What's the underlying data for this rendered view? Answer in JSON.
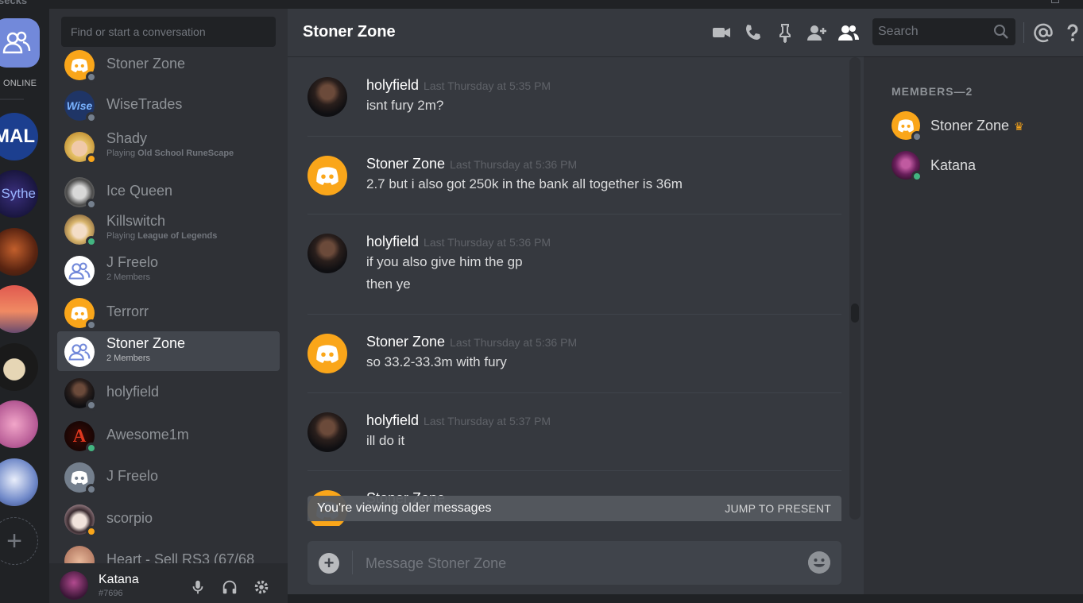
{
  "app": {
    "title": "secks"
  },
  "guilds": {
    "online_label": "ONLINE"
  },
  "dm_search": {
    "placeholder": "Find or start a conversation"
  },
  "dm_list": [
    {
      "name": "Stoner Zone",
      "sub": "",
      "status": "offline",
      "avatar": "discord-orange"
    },
    {
      "name": "WiseTrades",
      "sub": "",
      "status": "offline",
      "avatar": "wise"
    },
    {
      "name": "Shady",
      "sub_prefix": "Playing ",
      "sub_bold": "Old School RuneScape",
      "status": "idle",
      "avatar": "face-blond"
    },
    {
      "name": "Ice Queen",
      "sub": "",
      "status": "offline",
      "avatar": "dog"
    },
    {
      "name": "Killswitch",
      "sub_prefix": "Playing ",
      "sub_bold": "League of Legends",
      "status": "online",
      "avatar": "anime-blond"
    },
    {
      "name": "J Freelo",
      "sub": "2 Members",
      "status": "",
      "avatar": "group"
    },
    {
      "name": "Terrorr",
      "sub": "",
      "status": "offline",
      "avatar": "discord-orange"
    },
    {
      "name": "Stoner Zone",
      "sub": "2 Members",
      "status": "",
      "avatar": "group",
      "selected": true
    },
    {
      "name": "holyfield",
      "sub": "",
      "status": "offline",
      "avatar": "boxer"
    },
    {
      "name": "Awesome1m",
      "sub": "",
      "status": "online",
      "avatar": "letter-a"
    },
    {
      "name": "J Freelo",
      "sub": "",
      "status": "offline",
      "avatar": "discord-gray"
    },
    {
      "name": "scorpio",
      "sub": "",
      "status": "idle",
      "avatar": "anime-dark"
    },
    {
      "name": "Heart - Sell RS3 (67/68",
      "sub": "",
      "status": "",
      "avatar": "face-skin"
    }
  ],
  "user_panel": {
    "name": "Katana",
    "tag": "#7696"
  },
  "chat": {
    "title": "Stoner Zone",
    "search_placeholder": "Search",
    "messages": [
      {
        "author": "holyfield",
        "timestamp": "Last Thursday at 5:35 PM",
        "lines": [
          "isnt fury 2m?"
        ],
        "avatar": "boxer"
      },
      {
        "author": "Stoner Zone",
        "timestamp": "Last Thursday at 5:36 PM",
        "lines": [
          "2.7 but i also got 250k in the bank all together is 36m"
        ],
        "avatar": "discord-orange"
      },
      {
        "author": "holyfield",
        "timestamp": "Last Thursday at 5:36 PM",
        "lines": [
          "if you also give him the gp",
          "then ye"
        ],
        "avatar": "boxer"
      },
      {
        "author": "Stoner Zone",
        "timestamp": "Last Thursday at 5:36 PM",
        "lines": [
          "so 33.2-33.3m with fury"
        ],
        "avatar": "discord-orange"
      },
      {
        "author": "holyfield",
        "timestamp": "Last Thursday at 5:37 PM",
        "lines": [
          "ill do it"
        ],
        "avatar": "boxer"
      },
      {
        "author": "Stoner Zone",
        "timestamp": "",
        "lines": [],
        "avatar": "discord-orange"
      }
    ],
    "older_notice": "You're viewing older messages",
    "jump_label": "JUMP TO PRESENT",
    "composer_placeholder": "Message Stoner Zone"
  },
  "members": {
    "title": "MEMBERS—2",
    "list": [
      {
        "name": "Stoner Zone",
        "owner": true,
        "status": "offline",
        "avatar": "discord-orange"
      },
      {
        "name": "Katana",
        "owner": false,
        "status": "online",
        "avatar": "anime-purple"
      }
    ]
  },
  "colors": {
    "accent": "#7289da",
    "online": "#43b581",
    "idle": "#faa61a",
    "offline": "#747f8d",
    "discord_orange": "#faa61a"
  }
}
